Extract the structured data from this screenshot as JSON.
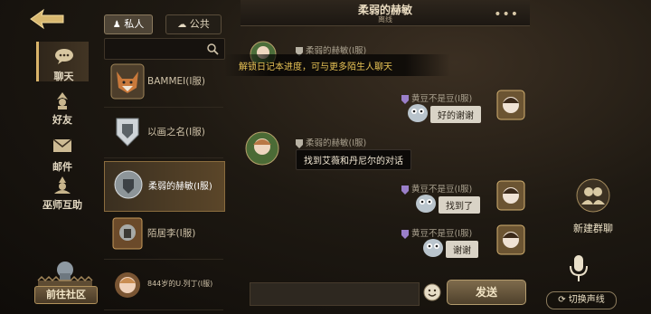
{
  "nav": {
    "chat": "聊天",
    "friends": "好友",
    "mail": "邮件",
    "wizard_help": "巫师互助",
    "community": "前往社区"
  },
  "tabs": {
    "private": "私人",
    "public": "公共"
  },
  "search": {
    "placeholder": ""
  },
  "contacts": [
    {
      "name": "BAMMEI(I服)"
    },
    {
      "name": "以画之名(I服)"
    },
    {
      "name": "柔弱的赫敏(I服)"
    },
    {
      "name": "陌居李(I服)"
    },
    {
      "name": "844岁的U.列丁(I服)"
    }
  ],
  "chat": {
    "title": "柔弱的赫敏",
    "status": "离线",
    "more": "•••"
  },
  "messages": {
    "sys_sender": "柔弱的赫敏(I服)",
    "sys_text": "解锁日记本进度，可与更多陌生人聊天",
    "m1_sender": "黄豆不是豆(I服)",
    "m1_text": "好的谢谢",
    "m2_sender": "柔弱的赫敏(I服)",
    "m2_text": "找到艾薇和丹尼尔的对话",
    "m3_sender": "黄豆不是豆(I服)",
    "m3_text": "找到了",
    "m4_sender": "黄豆不是豆(I服)",
    "m4_text": "谢谢"
  },
  "footer": {
    "send": "发送"
  },
  "right": {
    "new_group": "新建群聊",
    "switch_voice": "切换声线"
  },
  "colors": {
    "accent": "#d9b46a",
    "system_text": "#e7c255"
  }
}
